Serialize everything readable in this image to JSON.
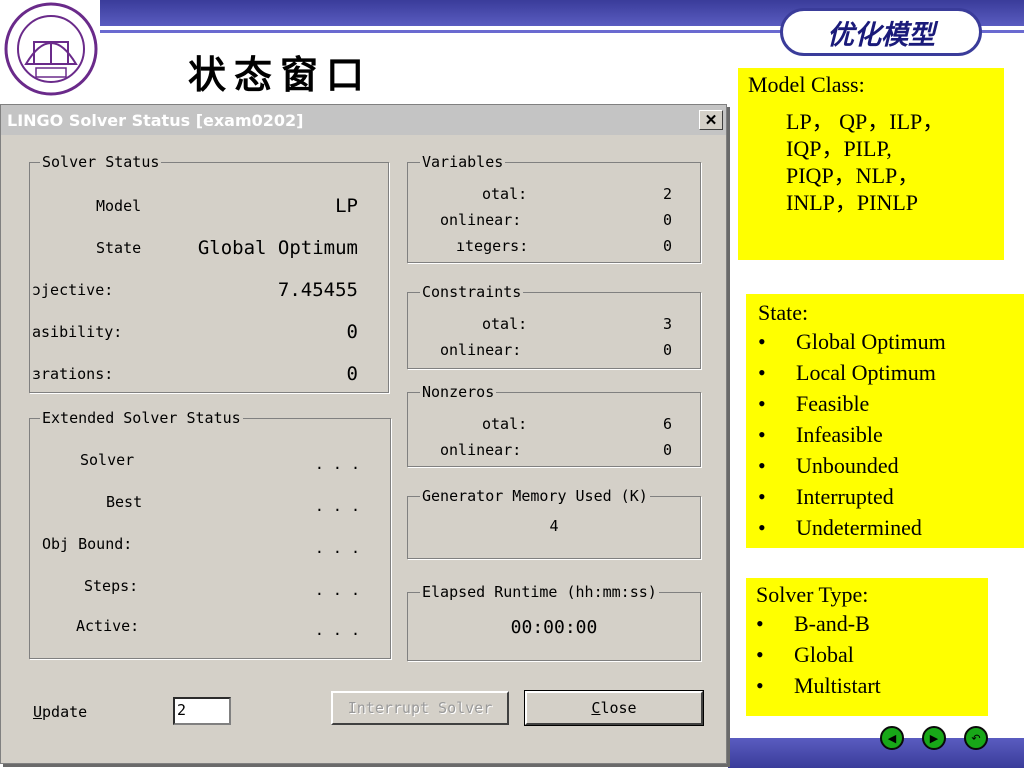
{
  "slide": {
    "title": "状态窗口",
    "badge": "优化模型"
  },
  "model_class_box": {
    "heading": "Model Class:",
    "lines": [
      "LP，  QP，ILP，",
      "IQP，PILP,",
      "PIQP，NLP，",
      "INLP，PINLP"
    ]
  },
  "state_box": {
    "heading": "State:",
    "items": [
      "Global Optimum",
      "Local Optimum",
      "Feasible",
      "Infeasible",
      "Unbounded",
      "Interrupted",
      "Undetermined"
    ]
  },
  "solver_type_box": {
    "heading": "Solver Type:",
    "items": [
      "B-and-B",
      "Global",
      "Multistart"
    ]
  },
  "bullet_glyph": "•",
  "nav": {
    "prev": "◀",
    "next": "▶",
    "return": "↶"
  },
  "dialog": {
    "title": "LINGO Solver Status [exam0202]",
    "close_glyph": "✕",
    "solver_status": {
      "legend": "Solver Status",
      "model_label": "Model",
      "model_value": "LP",
      "state_label": "State",
      "state_value": "Global Optimum",
      "objective_label": "ɔjective:",
      "objective_value": "7.45455",
      "infeasibility_label": "asibility:",
      "infeasibility_value": "0",
      "iterations_label": "ɜrations:",
      "iterations_value": "0"
    },
    "extended_status": {
      "legend": "Extended Solver Status",
      "rows": [
        {
          "label": "Solver",
          "value": ". . ."
        },
        {
          "label": "Best",
          "value": ". . ."
        },
        {
          "label": "Obj Bound:",
          "value": ". . ."
        },
        {
          "label": "Steps:",
          "value": ". . ."
        },
        {
          "label": "Active:",
          "value": ". . ."
        }
      ]
    },
    "variables": {
      "legend": "Variables",
      "total_label": "otal:",
      "total_value": "2",
      "nonlinear_label": "onlinear:",
      "nonlinear_value": "0",
      "integers_label": "ıtegers:",
      "integers_value": "0"
    },
    "constraints": {
      "legend": "Constraints",
      "total_label": "otal:",
      "total_value": "3",
      "nonlinear_label": "onlinear:",
      "nonlinear_value": "0"
    },
    "nonzeros": {
      "legend": "Nonzeros",
      "total_label": "otal:",
      "total_value": "6",
      "nonlinear_label": "onlinear:",
      "nonlinear_value": "0"
    },
    "memory": {
      "legend": "Generator Memory Used (K)",
      "value": "4"
    },
    "runtime": {
      "legend": "Elapsed Runtime (hh:mm:ss)",
      "value": "00:00:00"
    },
    "update": {
      "label_first": "U",
      "label_rest": "pdate",
      "value": "2"
    },
    "interrupt_button": "Interrupt Solver",
    "close_button_first": "C",
    "close_button_rest": "lose"
  }
}
